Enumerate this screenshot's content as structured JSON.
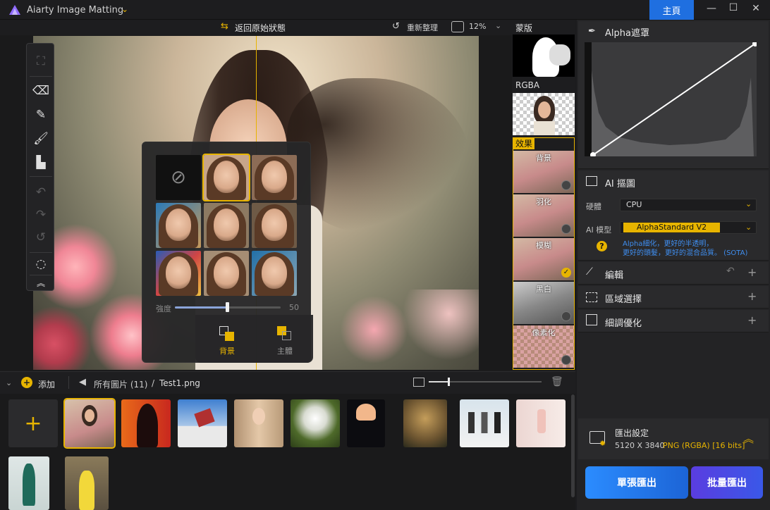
{
  "titlebar": {
    "app_title": "Aiarty Image Matting",
    "home_label": "主頁"
  },
  "canvas_toolbar": {
    "restore_label": "返回原始狀態",
    "reorganize_label": "重新整理",
    "zoom_value": "12%"
  },
  "bg_popup": {
    "strength_label": "強度",
    "strength_value": "50",
    "tab_background": "背景",
    "tab_subject": "主體"
  },
  "side_column": {
    "mask_label": "蒙版",
    "rgba_label": "RGBA",
    "effects_label": "效果",
    "effects": [
      {
        "label": "背景",
        "state": "dot"
      },
      {
        "label": "羽化",
        "state": "dot"
      },
      {
        "label": "模糊",
        "state": "check"
      },
      {
        "label": "黑白",
        "state": "dot"
      },
      {
        "label": "像素化",
        "state": "dot"
      }
    ]
  },
  "right_panel": {
    "alpha_title": "Alpha遮罩",
    "ai_matting_title": "AI 摳圖",
    "hardware_label": "硬體",
    "hardware_value": "CPU",
    "model_label": "AI 模型",
    "model_value": "AlphaStandard  V2",
    "model_desc_1": "Alpha細化，更好的半透明，",
    "model_desc_2": "更好的頭髮，更好的混合品質。 (SOTA)",
    "edit_title": "編輯",
    "region_title": "區域選擇",
    "fine_title": "細調優化",
    "export_title": "匯出設定",
    "export_size": "5120 X 3840",
    "export_format": "PNG (RGBA) [16 bits]",
    "single_export": "單張匯出",
    "batch_export": "批量匯出"
  },
  "filebar": {
    "add_label": "添加",
    "all_images": "所有圖片 (11)",
    "separator": "/",
    "filename": "Test1.png"
  },
  "colors": {
    "accent": "#e7b400",
    "primary": "#1f6fe0"
  }
}
